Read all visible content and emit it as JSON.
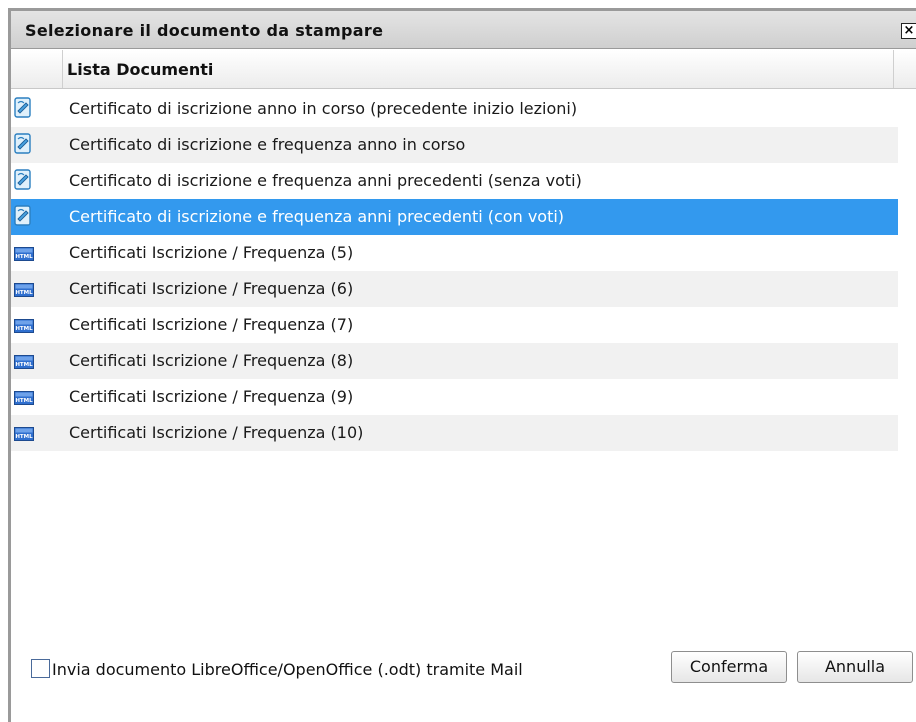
{
  "dialog": {
    "title": "Selezionare il documento da stampare",
    "close_label": "×"
  },
  "list": {
    "column_header": "Lista Documenti",
    "items": [
      {
        "label": "Certificato di iscrizione anno in corso (precedente inizio lezioni)",
        "icon": "writer-document-icon",
        "selected": false
      },
      {
        "label": "Certificato di iscrizione e frequenza anno in corso",
        "icon": "writer-document-icon",
        "selected": false
      },
      {
        "label": "Certificato di iscrizione e frequenza anni precedenti (senza voti)",
        "icon": "writer-document-icon",
        "selected": false
      },
      {
        "label": "Certificato di iscrizione e frequenza anni precedenti (con voti)",
        "icon": "writer-document-icon",
        "selected": true
      },
      {
        "label": "Certificati Iscrizione / Frequenza (5)",
        "icon": "html-file-icon",
        "selected": false
      },
      {
        "label": "Certificati Iscrizione / Frequenza (6)",
        "icon": "html-file-icon",
        "selected": false
      },
      {
        "label": "Certificati Iscrizione / Frequenza (7)",
        "icon": "html-file-icon",
        "selected": false
      },
      {
        "label": "Certificati Iscrizione / Frequenza (8)",
        "icon": "html-file-icon",
        "selected": false
      },
      {
        "label": "Certificati Iscrizione / Frequenza (9)",
        "icon": "html-file-icon",
        "selected": false
      },
      {
        "label": "Certificati Iscrizione / Frequenza (10)",
        "icon": "html-file-icon",
        "selected": false
      }
    ]
  },
  "footer": {
    "mail_checkbox_label": "Invia documento LibreOffice/OpenOffice (.odt) tramite Mail",
    "mail_checkbox_checked": false,
    "confirm_label": "Conferma",
    "cancel_label": "Annulla"
  },
  "colors": {
    "selection": "#3399ee",
    "row_alt": "#f1f1f1"
  }
}
